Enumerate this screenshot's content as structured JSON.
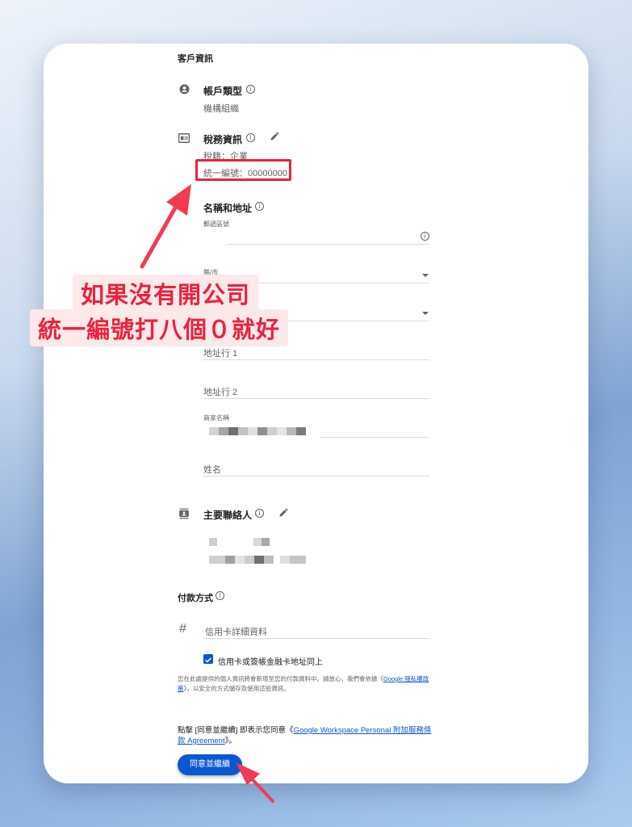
{
  "customer": {
    "section_title": "客戶資訊",
    "account_type": {
      "label": "帳戶類型",
      "value": "機構組織"
    },
    "tax_info": {
      "label": "稅務資訊",
      "tax_status": "稅籍：企業",
      "tax_id": "統一編號：00000000"
    },
    "name_address": {
      "label": "名稱和地址",
      "postal_label": "郵遞區號",
      "county_label": "縣/市",
      "address1": "地址行 1",
      "address2": "地址行 2",
      "business_name_label": "商家名稱",
      "name_placeholder": "姓名"
    },
    "primary_contact": {
      "label": "主要聯絡人"
    }
  },
  "payment": {
    "section_title": "付款方式",
    "card_placeholder": "信用卡詳細資料",
    "same_address_label": "信用卡或簽帳金融卡地址同上",
    "same_address_checked": true,
    "privacy_text_pre": "您在此處提供的個人資訊將會新增至您的付款資料中。請放心，我們會依據《",
    "privacy_link": "Google 隱私權政策",
    "privacy_text_post": "》，以安全的方式儲存及使用這些資訊。"
  },
  "agreement": {
    "text_pre": "點擊 [同意並繼續] 即表示您同意《",
    "link": "Google Workspace Personal 附加服務條款 Agreement",
    "text_post": "》。"
  },
  "continue_button": "同意並繼續",
  "annotation": {
    "line1": "如果沒有開公司",
    "line2": "統一編號打八個０就好"
  },
  "colors": {
    "accent": "#0b57d0",
    "annotation_red": "#e8243c"
  }
}
